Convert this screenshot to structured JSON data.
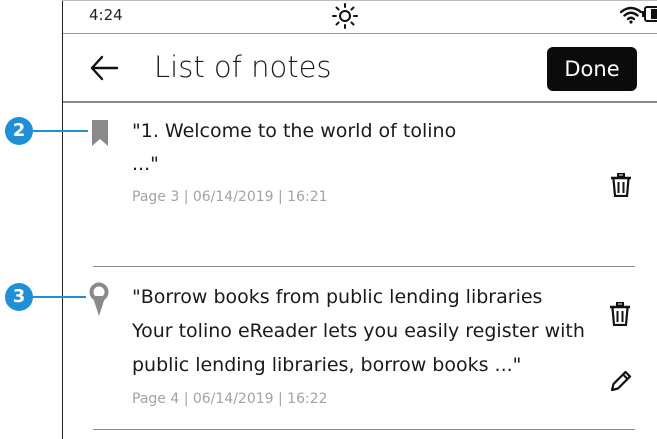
{
  "status_bar": {
    "time": "4:24",
    "icons": [
      "brightness-icon",
      "wifi-icon",
      "battery-icon"
    ]
  },
  "header": {
    "title": "List of notes",
    "done_label": "Done",
    "back_icon": "arrow-left-icon"
  },
  "callouts": [
    "2",
    "3"
  ],
  "notes": [
    {
      "type": "bookmark",
      "icon": "bookmark-icon",
      "lines": [
        "\"1. Welcome to the world of tolino",
        "...\""
      ],
      "meta": "Page 3 | 06/14/2019 | 16:21",
      "actions": [
        "trash-icon"
      ]
    },
    {
      "type": "highlight",
      "icon": "location-pin-icon",
      "lines": [
        "\"Borrow books from public lending libraries",
        "Your tolino eReader lets you easily register with",
        "public lending libraries, borrow books ...\""
      ],
      "meta": "Page 4 | 06/14/2019 | 16:22",
      "actions": [
        "trash-icon",
        "pencil-icon"
      ]
    }
  ],
  "colors": {
    "callout": "#1f90d8",
    "done_button_bg": "#0b0b0b",
    "meta_text": "#a3a3a3",
    "icon_gray": "#8a8a8a"
  }
}
